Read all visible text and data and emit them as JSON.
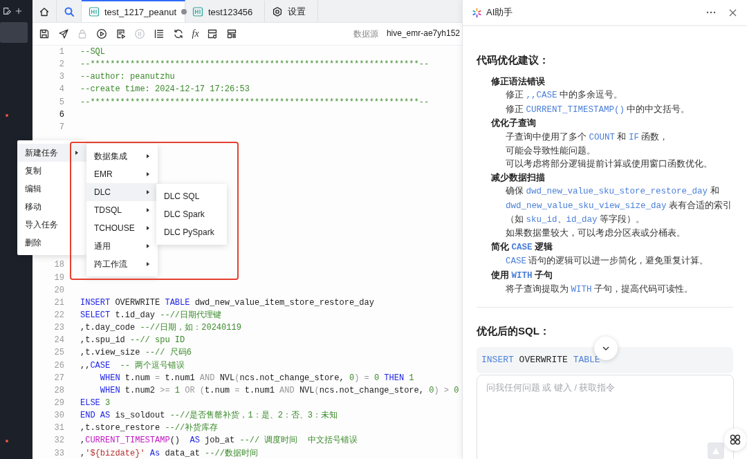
{
  "sidebar": {
    "items": [
      {
        "selected": true
      }
    ]
  },
  "tabs": [
    {
      "kind": "home",
      "selected": false
    },
    {
      "kind": "search",
      "selected": false
    },
    {
      "kind": "file",
      "label": "test_1217_peanut",
      "selected": true,
      "modified": true
    },
    {
      "kind": "file",
      "label": "test123456",
      "selected": false,
      "modified": false
    },
    {
      "kind": "settings",
      "label": "设置",
      "selected": false
    }
  ],
  "toolbar": {
    "tools": [
      {
        "kind": "save",
        "disabled": false
      },
      {
        "kind": "send",
        "disabled": false
      },
      {
        "kind": "lock",
        "disabled": true
      },
      {
        "kind": "run",
        "disabled": false
      },
      {
        "kind": "run-file",
        "disabled": false
      },
      {
        "kind": "pause",
        "disabled": true
      },
      {
        "kind": "list",
        "disabled": false
      },
      {
        "kind": "refresh",
        "disabled": false
      },
      {
        "kind": "formula",
        "label": "fx",
        "disabled": false
      },
      {
        "kind": "config",
        "disabled": false
      },
      {
        "kind": "config-list",
        "disabled": false
      }
    ],
    "datasource": {
      "label": "数据源",
      "value": "hive_emr-ae7yh152"
    }
  },
  "editor": {
    "lines": [
      {
        "number": "1",
        "current": false,
        "tokens": [
          {
            "kind": "comment",
            "text": "--SQL"
          }
        ]
      },
      {
        "number": "2",
        "current": false,
        "tokens": [
          {
            "kind": "comment",
            "text": "--******************************************************************--"
          }
        ]
      },
      {
        "number": "3",
        "current": false,
        "tokens": [
          {
            "kind": "comment",
            "text": "--author: peanutzhu"
          }
        ]
      },
      {
        "number": "4",
        "current": false,
        "tokens": [
          {
            "kind": "comment",
            "text": "--create time: 2024-12-17 17:26:53"
          }
        ]
      },
      {
        "number": "5",
        "current": false,
        "tokens": [
          {
            "kind": "comment",
            "text": "--******************************************************************--"
          }
        ]
      },
      {
        "number": "6",
        "current": true
      },
      {
        "number": "7",
        "current": false
      },
      {
        "number": "18",
        "current": false
      },
      {
        "number": "19",
        "current": false
      },
      {
        "number": "20",
        "current": false
      },
      {
        "number": "21",
        "current": false,
        "tokens": [
          {
            "kind": "keyword",
            "text": "INSERT "
          },
          {
            "kind": "plain",
            "text": "OVERWRITE "
          },
          {
            "kind": "keyword",
            "text": "TABLE "
          },
          {
            "kind": "plain",
            "text": "dwd_new_value_item_store_restore_day"
          }
        ]
      },
      {
        "number": "22",
        "current": false,
        "tokens": [
          {
            "kind": "keyword",
            "text": "SELECT "
          },
          {
            "kind": "plain",
            "text": "t.id_day "
          },
          {
            "kind": "comment",
            "text": "--//日期代理键"
          }
        ]
      },
      {
        "number": "23",
        "current": false,
        "tokens": [
          {
            "kind": "plain",
            "text": ",t.day_code "
          },
          {
            "kind": "comment",
            "text": "--//日期，如：20240119"
          }
        ]
      },
      {
        "number": "24",
        "current": false,
        "tokens": [
          {
            "kind": "plain",
            "text": ",t.spu_id "
          },
          {
            "kind": "comment",
            "text": "--// spu ID"
          }
        ]
      },
      {
        "number": "25",
        "current": false,
        "tokens": [
          {
            "kind": "plain",
            "text": ",t.view_size "
          },
          {
            "kind": "comment",
            "text": "--// 尺码6"
          }
        ]
      },
      {
        "number": "26",
        "current": false,
        "tokens": [
          {
            "kind": "plain",
            "text": ",,"
          },
          {
            "kind": "keyword",
            "text": "CASE"
          },
          {
            "kind": "comment",
            "text": "  -- 两个逗号错误"
          }
        ]
      },
      {
        "number": "27",
        "current": false,
        "tokens": [
          {
            "kind": "keyword",
            "text": "    WHEN "
          },
          {
            "kind": "plain",
            "text": "t.num "
          },
          {
            "kind": "operator",
            "text": "= "
          },
          {
            "kind": "plain",
            "text": "t.num1 "
          },
          {
            "kind": "operator",
            "text": "AND "
          },
          {
            "kind": "plain",
            "text": "NVL"
          },
          {
            "kind": "operator",
            "text": "("
          },
          {
            "kind": "plain",
            "text": "ncs.not_change_store, "
          },
          {
            "kind": "number",
            "text": "0"
          },
          {
            "kind": "operator",
            "text": ") = "
          },
          {
            "kind": "number",
            "text": "0 "
          },
          {
            "kind": "keyword",
            "text": "THEN "
          },
          {
            "kind": "number",
            "text": "1"
          }
        ]
      },
      {
        "number": "28",
        "current": false,
        "tokens": [
          {
            "kind": "keyword",
            "text": "    WHEN "
          },
          {
            "kind": "plain",
            "text": "t.num2 "
          },
          {
            "kind": "operator",
            "text": ">= "
          },
          {
            "kind": "number",
            "text": "1 "
          },
          {
            "kind": "operator",
            "text": "OR ("
          },
          {
            "kind": "plain",
            "text": "t.num "
          },
          {
            "kind": "operator",
            "text": "= "
          },
          {
            "kind": "plain",
            "text": "t.num1 "
          },
          {
            "kind": "operator",
            "text": "AND "
          },
          {
            "kind": "plain",
            "text": "NVL"
          },
          {
            "kind": "operator",
            "text": "("
          },
          {
            "kind": "plain",
            "text": "ncs.not_change_store, "
          },
          {
            "kind": "number",
            "text": "0"
          },
          {
            "kind": "operator",
            "text": ") > "
          },
          {
            "kind": "number",
            "text": "0"
          }
        ]
      },
      {
        "number": "29",
        "current": false,
        "tokens": [
          {
            "kind": "keyword",
            "text": "ELSE "
          },
          {
            "kind": "number",
            "text": "3"
          }
        ]
      },
      {
        "number": "30",
        "current": false,
        "tokens": [
          {
            "kind": "keyword",
            "text": "END AS "
          },
          {
            "kind": "plain",
            "text": "is_soldout "
          },
          {
            "kind": "comment",
            "text": "--//是否售罄补货，1：是、2：否、3：未知"
          }
        ]
      },
      {
        "number": "31",
        "current": false,
        "tokens": [
          {
            "kind": "plain",
            "text": ",t.store_restore "
          },
          {
            "kind": "comment",
            "text": "--//补货库存"
          }
        ]
      },
      {
        "number": "32",
        "current": false,
        "tokens": [
          {
            "kind": "plain",
            "text": ","
          },
          {
            "kind": "function",
            "text": "CURRENT_TIMESTAMP"
          },
          {
            "kind": "plain",
            "text": "()  "
          },
          {
            "kind": "keyword",
            "text": "AS "
          },
          {
            "kind": "plain",
            "text": "job_at "
          },
          {
            "kind": "comment",
            "text": "--// 调度时间  中文括号错误"
          }
        ]
      },
      {
        "number": "33",
        "current": false,
        "tokens": [
          {
            "kind": "plain",
            "text": ","
          },
          {
            "kind": "string",
            "text": "'${bizdate}'"
          },
          {
            "kind": "keyword",
            "text": " As "
          },
          {
            "kind": "plain",
            "text": "data_at "
          },
          {
            "kind": "comment",
            "text": "--//数据时间"
          }
        ]
      }
    ]
  },
  "context_menu": {
    "items": [
      {
        "label": "新建任务",
        "selected": true,
        "has_submenu": true,
        "children": [
          {
            "label": "数据集成",
            "selected": false,
            "has_submenu": true
          },
          {
            "label": "EMR",
            "selected": false,
            "has_submenu": true
          },
          {
            "label": "DLC",
            "selected": true,
            "has_submenu": true,
            "children": [
              {
                "label": "DLC SQL",
                "selected": false,
                "has_submenu": false
              },
              {
                "label": "DLC Spark",
                "selected": false,
                "has_submenu": false
              },
              {
                "label": "DLC PySpark",
                "selected": false,
                "has_submenu": false
              }
            ]
          },
          {
            "label": "TDSQL",
            "selected": false,
            "has_submenu": true
          },
          {
            "label": "TCHOUSE",
            "selected": false,
            "has_submenu": true
          },
          {
            "label": "通用",
            "selected": false,
            "has_submenu": true
          },
          {
            "label": "跨工作流",
            "selected": false,
            "has_submenu": true
          }
        ]
      },
      {
        "label": "复制",
        "selected": false,
        "has_submenu": false
      },
      {
        "label": "编辑",
        "selected": false,
        "has_submenu": false
      },
      {
        "label": "移动",
        "selected": false,
        "has_submenu": false
      },
      {
        "label": "导入任务",
        "selected": false,
        "has_submenu": false
      },
      {
        "label": "删除",
        "selected": false,
        "has_submenu": false
      }
    ]
  },
  "ai_panel": {
    "title": "AI助手",
    "heading": "代码优化建议：",
    "sections": [
      {
        "title": [
          {
            "kind": "text",
            "text": "修正语法错误"
          }
        ],
        "lines": [
          [
            {
              "kind": "text",
              "text": "修正 "
            },
            {
              "kind": "code",
              "text": ",,CASE"
            },
            {
              "kind": "text",
              "text": " 中的多余逗号。"
            }
          ],
          [
            {
              "kind": "text",
              "text": "修正 "
            },
            {
              "kind": "code",
              "text": "CURRENT_TIMESTAMP()"
            },
            {
              "kind": "text",
              "text": "  中的中文括号。"
            }
          ]
        ]
      },
      {
        "title": [
          {
            "kind": "text",
            "text": "优化子查询"
          }
        ],
        "lines": [
          [
            {
              "kind": "text",
              "text": "子查询中使用了多个 "
            },
            {
              "kind": "code",
              "text": "COUNT"
            },
            {
              "kind": "text",
              "text": " 和 "
            },
            {
              "kind": "code",
              "text": "IF"
            },
            {
              "kind": "text",
              "text": " 函数，"
            }
          ],
          [
            {
              "kind": "text",
              "text": "可能会导致性能问题。"
            }
          ],
          [
            {
              "kind": "text",
              "text": "可以考虑将部分逻辑提前计算或使用窗口函数优化。"
            }
          ]
        ]
      },
      {
        "title": [
          {
            "kind": "text",
            "text": "减少数据扫描"
          }
        ],
        "lines": [
          [
            {
              "kind": "text",
              "text": "确保 "
            },
            {
              "kind": "code",
              "text": "dwd_new_value_sku_store_restore_day"
            },
            {
              "kind": "text",
              "text": " 和"
            }
          ],
          [
            {
              "kind": "code",
              "text": "dwd_new_value_sku_view_size_day"
            },
            {
              "kind": "text",
              "text": " 表有合适的索引"
            }
          ],
          [
            {
              "kind": "text",
              "text": "（如 "
            },
            {
              "kind": "code",
              "text": "sku_id"
            },
            {
              "kind": "text",
              "text": "、"
            },
            {
              "kind": "code",
              "text": "id_day"
            },
            {
              "kind": "text",
              "text": " 等字段）。"
            }
          ],
          [
            {
              "kind": "text",
              "text": "如果数据量较大，可以考虑分区表或分桶表。"
            }
          ]
        ]
      },
      {
        "title": [
          {
            "kind": "text",
            "text": "简化 "
          },
          {
            "kind": "code",
            "text": "CASE"
          },
          {
            "kind": "text",
            "text": " 逻辑"
          }
        ],
        "lines": [
          [
            {
              "kind": "code",
              "text": "CASE"
            },
            {
              "kind": "text",
              "text": " 语句的逻辑可以进一步简化，避免重复计算。"
            }
          ]
        ]
      },
      {
        "title": [
          {
            "kind": "text",
            "text": "使用 "
          },
          {
            "kind": "code",
            "text": "WITH"
          },
          {
            "kind": "text",
            "text": " 子句"
          }
        ],
        "lines": [
          [
            {
              "kind": "text",
              "text": "将子查询提取为 "
            },
            {
              "kind": "code",
              "text": "WITH"
            },
            {
              "kind": "text",
              "text": " 子句，提高代码可读性。"
            }
          ]
        ]
      }
    ],
    "result_heading": "优化后的SQL：",
    "code_preview": [
      {
        "kind": "keyword",
        "text": "INSERT "
      },
      {
        "kind": "plain",
        "text": "OVERWRITE "
      },
      {
        "kind": "keyword",
        "text": "TABLE"
      }
    ],
    "input": {
      "placeholder": "问我任何问题 或 键入 / 获取指令"
    }
  }
}
